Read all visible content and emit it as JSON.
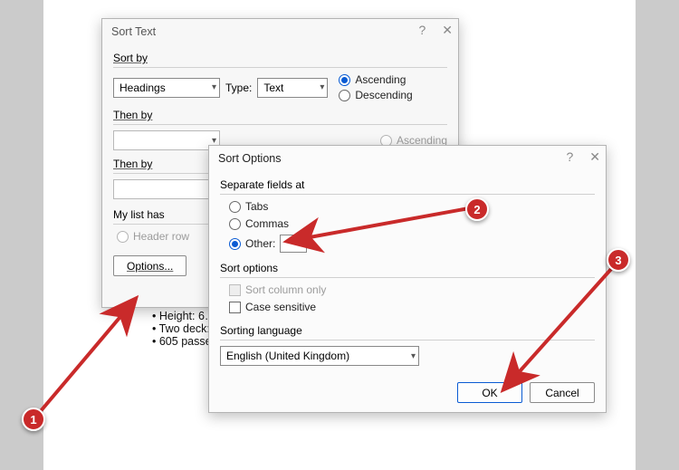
{
  "sortText": {
    "title": "Sort Text",
    "sortBy": {
      "label": "Sort by",
      "field": "Headings",
      "typeLabel": "Type:",
      "type": "Text",
      "asc": "Ascending",
      "desc": "Descending"
    },
    "thenBy1": {
      "label": "Then by",
      "asc": "Ascending"
    },
    "thenBy2": {
      "label": "Then by"
    },
    "myList": {
      "label": "My list has",
      "headerRow": "Header row"
    },
    "optionsBtn": "Options..."
  },
  "sortOptions": {
    "title": "Sort Options",
    "separate": {
      "label": "Separate fields at",
      "tabs": "Tabs",
      "commas": "Commas",
      "other": "Other:"
    },
    "opts": {
      "label": "Sort options",
      "colOnly": "Sort column only",
      "caseSens": "Case sensitive"
    },
    "lang": {
      "label": "Sorting language",
      "value": "English (United Kingdom)"
    },
    "ok": "OK",
    "cancel": "Cancel"
  },
  "bullets": {
    "a": "Height: 6…",
    "b": "Two deck:",
    "c": "605 passe"
  },
  "annot": {
    "n1": "1",
    "n2": "2",
    "n3": "3"
  }
}
